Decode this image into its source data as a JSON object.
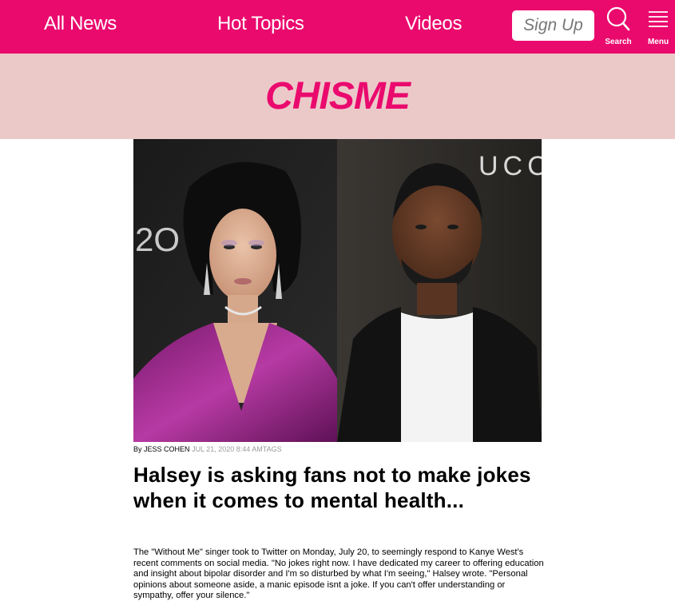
{
  "nav": {
    "items": [
      {
        "label": "All News"
      },
      {
        "label": "Hot Topics"
      },
      {
        "label": "Videos"
      }
    ],
    "signup_label": "Sign Up",
    "search_label": "Search",
    "menu_label": "Menu"
  },
  "brand": {
    "name": "CHISME"
  },
  "article": {
    "image_icons": [
      "halsey-photo",
      "kanye-photo"
    ],
    "byline_prefix": "By",
    "author": "JESS COHEN",
    "meta": "JUL 21, 2020 8:44 AMTAGS",
    "headline": "Halsey is asking fans not to make jokes when it comes to mental health...",
    "body": "The \"Without Me\" singer took to Twitter on Monday, July 20, to seemingly respond to Kanye West's recent comments on social media. \"No jokes right now. I have dedicated my career to offering education and insight about bipolar disorder and I'm so disturbed by what I'm seeing,\" Halsey wrote. \"Personal opinions about someone aside, a manic episode isnt a joke. If you can't offer understanding or sympathy, offer your silence.\""
  },
  "colors": {
    "accent": "#ea0a6e",
    "brand_band": "#ecc9c9"
  }
}
